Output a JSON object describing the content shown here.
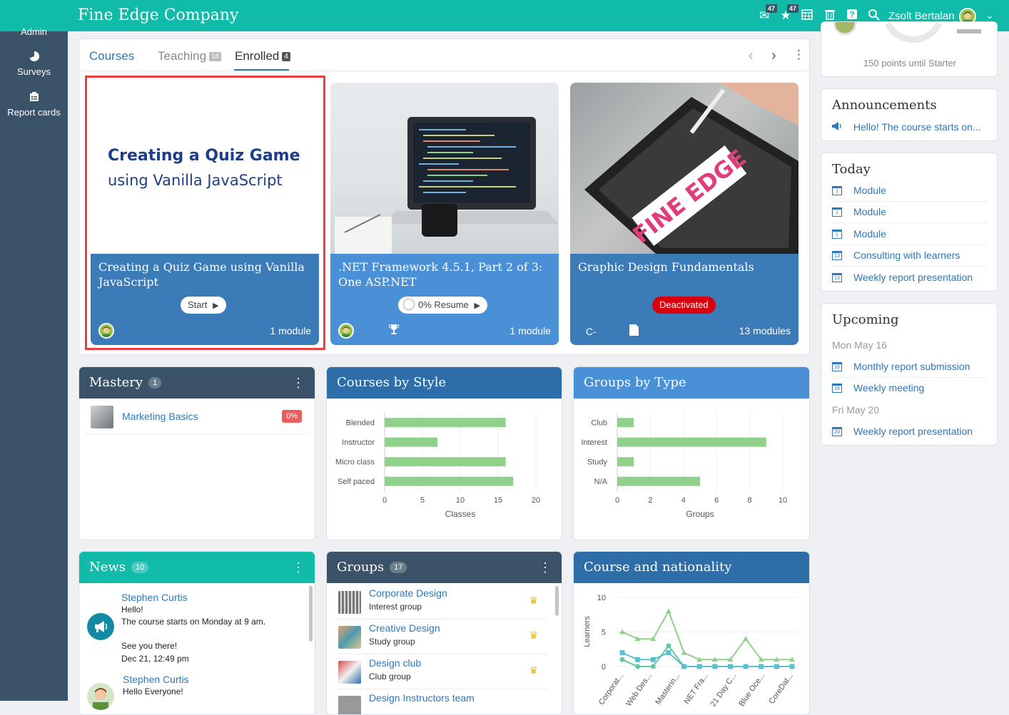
{
  "topbar": {
    "brand": "Fine Edge Company",
    "messages_badge": "47",
    "notifications_badge": "47",
    "user_name": "Zsolt Bertalan"
  },
  "sidebar": {
    "items": [
      {
        "label": "Admin",
        "icon": "admin-icon"
      },
      {
        "label": "Surveys",
        "icon": "pie-icon"
      },
      {
        "label": "Report cards",
        "icon": "report-icon"
      }
    ]
  },
  "courses": {
    "tabs": [
      {
        "label": "Courses",
        "count": ""
      },
      {
        "label": "Teaching",
        "count": "16"
      },
      {
        "label": "Enrolled",
        "count": "4"
      }
    ],
    "tiles": [
      {
        "image_title_1": "Creating a Quiz Game",
        "image_title_2": "using Vanilla JavaScript",
        "title": "Creating a Quiz Game using Vanilla JavaScript",
        "action": "Start",
        "modules": "1 module"
      },
      {
        "title": ".NET Framework 4.5.1, Part 2 of 3: One ASP.NET",
        "progress": "0%",
        "progress_value": 0,
        "action": "Resume",
        "modules": "1 module"
      },
      {
        "image_brand": "FINE EDGE",
        "title": "Graphic Design Fundamentals",
        "status": "Deactivated",
        "grade": "C-",
        "modules": "13 modules"
      }
    ]
  },
  "mastery": {
    "title": "Mastery",
    "count": "1",
    "items": [
      {
        "name": "Marketing Basics",
        "progress": "0%"
      }
    ]
  },
  "courses_by_style": {
    "title": "Courses by Style"
  },
  "groups_by_type": {
    "title": "Groups by Type"
  },
  "course_nationality": {
    "title": "Course and nationality"
  },
  "chart_data": [
    {
      "type": "bar",
      "orientation": "horizontal",
      "title": "Courses by Style",
      "categories": [
        "Blended",
        "Instructor",
        "Micro class",
        "Self paced"
      ],
      "values": [
        16,
        7,
        16,
        17
      ],
      "xlabel": "Classes",
      "xlim": [
        0,
        20
      ],
      "xticks": [
        0,
        5,
        10,
        15,
        20
      ],
      "color": "#8fd18b",
      "grid": true
    },
    {
      "type": "bar",
      "orientation": "horizontal",
      "title": "Groups by Type",
      "categories": [
        "Club",
        "Interest",
        "Study",
        "N/A"
      ],
      "values": [
        1,
        9,
        1,
        5
      ],
      "xlabel": "Groups",
      "xlim": [
        0,
        10
      ],
      "xticks": [
        0,
        2,
        4,
        6,
        8,
        10
      ],
      "color": "#8fd18b",
      "grid": true
    },
    {
      "type": "line",
      "title": "Course and nationality",
      "ylabel": "Learners",
      "ylim": [
        0,
        10
      ],
      "yticks": [
        0,
        5,
        10
      ],
      "categories": [
        "Corporat...",
        "Web Des...",
        "Masterin...",
        "NET Fra...",
        "21 Day C...",
        "Blue Oce...",
        "CoreDat..."
      ],
      "x_points": 12,
      "series": [
        {
          "color": "#8fd18b",
          "marker": "triangle",
          "values": [
            5,
            4,
            4,
            8,
            2,
            1,
            1,
            1,
            4,
            1,
            1,
            1
          ]
        },
        {
          "color": "#66c89f",
          "marker": "circle",
          "values": [
            1,
            0,
            0,
            3,
            0,
            0,
            0,
            0,
            0,
            0,
            0,
            0
          ]
        },
        {
          "color": "#5bbfd0",
          "marker": "square",
          "values": [
            2,
            1,
            1,
            2,
            0,
            0,
            0,
            0,
            0,
            0,
            0,
            0
          ]
        }
      ]
    }
  ],
  "news": {
    "title": "News",
    "count": "10",
    "items": [
      {
        "author": "Stephen Curtis",
        "line1": "Hello!",
        "line2": "The course starts on Monday at 9 am.",
        "line3": "See you there!",
        "date": "Dec 21, 12:49 pm"
      },
      {
        "author": "Stephen Curtis",
        "line1": "Hello Everyone!"
      }
    ]
  },
  "groups": {
    "title": "Groups",
    "count": "17",
    "items": [
      {
        "name": "Corporate Design",
        "type": "Interest group"
      },
      {
        "name": "Creative Design",
        "type": "Study group"
      },
      {
        "name": "Design club",
        "type": "Club group"
      },
      {
        "name": "Design Instructors team",
        "type": ""
      }
    ]
  },
  "points": {
    "text": "150 points until Starter"
  },
  "announcements": {
    "title": "Announcements",
    "items": [
      "Hello! The course starts on..."
    ]
  },
  "today": {
    "title": "Today",
    "items": [
      {
        "label": "Module",
        "day": "1"
      },
      {
        "label": "Module",
        "day": "1"
      },
      {
        "label": "Module",
        "day": "1"
      },
      {
        "label": "Consulting with learners",
        "day": "13"
      },
      {
        "label": "Weekly report presentation",
        "day": "13"
      }
    ]
  },
  "upcoming": {
    "title": "Upcoming",
    "date1": "Mon May 16",
    "items1": [
      {
        "label": "Monthly report submission",
        "day": "16"
      },
      {
        "label": "Weekly meeting",
        "day": "16"
      }
    ],
    "date2": "Fri May 20",
    "items2": [
      {
        "label": "Weekly report presentation",
        "day": "20"
      }
    ]
  }
}
